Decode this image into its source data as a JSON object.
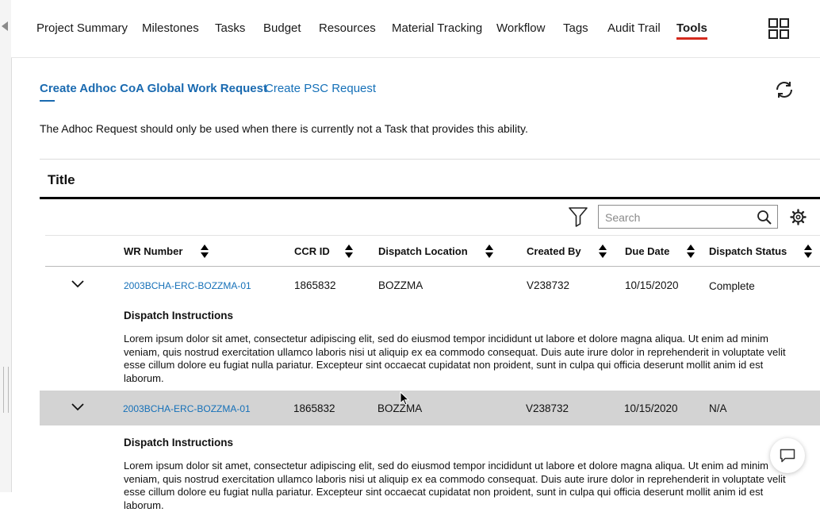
{
  "nav": {
    "items": [
      {
        "label": "Project Summary"
      },
      {
        "label": "Milestones"
      },
      {
        "label": "Tasks"
      },
      {
        "label": "Budget"
      },
      {
        "label": "Resources"
      },
      {
        "label": "Material Tracking"
      },
      {
        "label": "Workflow"
      },
      {
        "label": "Tags"
      },
      {
        "label": "Audit Trail"
      },
      {
        "label": "Tools",
        "active": true
      }
    ]
  },
  "tools": {
    "tabs": [
      {
        "label": "Create Adhoc CoA Global Work Request",
        "active": true
      },
      {
        "label": "Create PSC Request"
      }
    ],
    "notice": "The Adhoc Request should only be used when there is currently not a Task that provides this ability."
  },
  "table": {
    "title": "Title",
    "search_placeholder": "Search",
    "columns": [
      "WR Number",
      "CCR ID",
      "Dispatch Location",
      "Created By",
      "Due Date",
      "Dispatch Status"
    ],
    "rows": [
      {
        "wr_number": "2003BCHA-ERC-BOZZMA-01",
        "ccr_id": "1865832",
        "dispatch_location": "BOZZMA",
        "created_by": "V238732",
        "due_date": "10/15/2020",
        "dispatch_status": "Complete",
        "detail_title": "Dispatch Instructions",
        "detail_text": "Lorem ipsum dolor sit amet, consectetur adipiscing elit, sed do eiusmod tempor incididunt ut labore et dolore magna aliqua. Ut enim ad minim veniam, quis nostrud exercitation ullamco laboris nisi ut aliquip ex ea commodo consequat. Duis aute irure dolor in reprehenderit in voluptate velit esse cillum dolore eu fugiat nulla pariatur. Excepteur sint occaecat cupidatat non proident, sunt in culpa qui officia deserunt mollit anim id est laborum."
      },
      {
        "wr_number": "2003BCHA-ERC-BOZZMA-01",
        "ccr_id": "1865832",
        "dispatch_location": "BOZZMA",
        "created_by": "V238732",
        "due_date": "10/15/2020",
        "dispatch_status": "N/A",
        "detail_title": "Dispatch Instructions",
        "detail_text": "Lorem ipsum dolor sit amet, consectetur adipiscing elit, sed do eiusmod tempor incididunt ut labore et dolore magna aliqua. Ut enim ad minim veniam, quis nostrud exercitation ullamco laboris nisi ut aliquip ex ea commodo consequat. Duis aute irure dolor in reprehenderit in voluptate velit esse cillum dolore eu fugiat nulla pariatur. Excepteur sint occaecat cupidatat non proident, sunt in culpa qui officia deserunt mollit anim id est laborum."
      }
    ]
  },
  "icons": {
    "apps": "apps-grid-icon",
    "refresh": "refresh-icon",
    "filter": "filter-icon",
    "search": "search-icon",
    "settings": "gear-icon",
    "expand": "chevron-down-icon",
    "chat": "chat-icon"
  },
  "colors": {
    "active_nav_underline": "#d52b1e",
    "link": "#1570b8",
    "row_hover": "#d3d3d3"
  }
}
